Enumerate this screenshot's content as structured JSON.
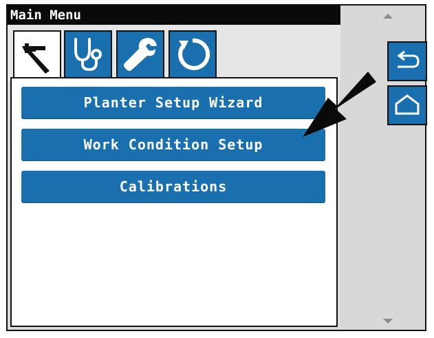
{
  "window": {
    "title": "Main Menu"
  },
  "tabs": [
    {
      "icon": "caliper-tools-icon",
      "active": true
    },
    {
      "icon": "stethoscope-icon",
      "active": false
    },
    {
      "icon": "wrench-icon",
      "active": false
    },
    {
      "icon": "refresh-icon",
      "active": false
    }
  ],
  "menu": {
    "items": [
      {
        "label": "Planter Setup Wizard"
      },
      {
        "label": "Work Condition Setup"
      },
      {
        "label": "Calibrations"
      }
    ]
  },
  "sidebar": {
    "back_icon": "back-arrow-icon",
    "home_icon": "home-icon"
  },
  "colors": {
    "accent": "#1a6fae",
    "titlebar": "#0a0a0a",
    "panel": "#ffffff"
  }
}
